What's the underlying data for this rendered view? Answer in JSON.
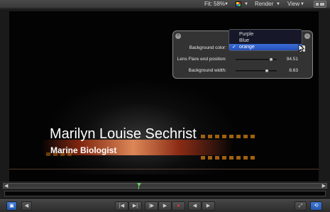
{
  "toolbar": {
    "fit_label": "Fit:",
    "fit_value": "58%",
    "render_label": "Render",
    "view_label": "View"
  },
  "canvas": {
    "title": "Marilyn Louise Sechrist",
    "subtitle": "Marine Biologist"
  },
  "hud": {
    "rows": [
      {
        "label": "Background color:"
      },
      {
        "label": "Lens Flare end position:",
        "value": "94.51",
        "slider_fraction": 0.87
      },
      {
        "label": "Background width:",
        "value": "8.63",
        "slider_fraction": 0.75
      }
    ]
  },
  "color_menu": {
    "items": [
      {
        "label": "Purple",
        "selected": false
      },
      {
        "label": "Blue",
        "selected": false
      },
      {
        "label": "orange",
        "selected": true
      }
    ],
    "check": "✓"
  },
  "colors": {
    "accent": "#2f63c8",
    "playhead": "#66cc66",
    "flare": "#e08c5a"
  }
}
